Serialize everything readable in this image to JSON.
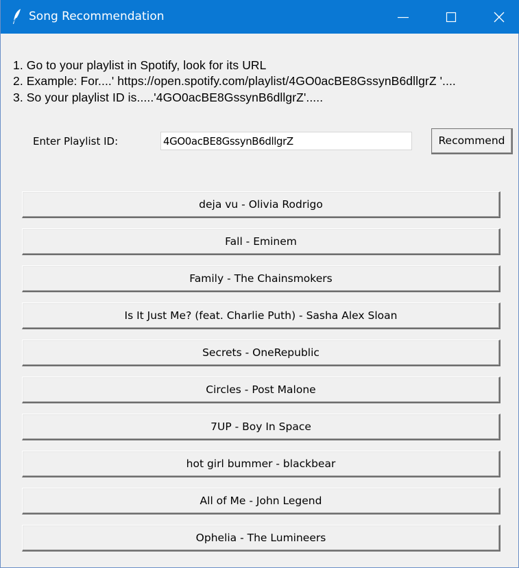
{
  "window": {
    "title": "Song Recommendation",
    "app_icon": "feather-icon",
    "controls": [
      "minimize-icon",
      "maximize-icon",
      "close-icon"
    ],
    "titlebar_color": "#0a78d4"
  },
  "instructions": [
    "1. Go to your playlist in Spotify, look for its URL",
    "2. Example: For....' https://open.spotify.com/playlist/4GO0acBE8GssynB6dllgrZ '....",
    "3. So your playlist ID is.....'4GO0acBE8GssynB6dllgrZ'....."
  ],
  "form": {
    "label": "Enter Playlist ID:",
    "playlist_id_value": "4GO0acBE8GssynB6dllgrZ",
    "recommend_label": "Recommend"
  },
  "songs": [
    "deja vu - Olivia Rodrigo",
    "Fall - Eminem",
    "Family - The Chainsmokers",
    "Is It Just Me? (feat. Charlie Puth) - Sasha Alex Sloan",
    "Secrets - OneRepublic",
    "Circles - Post Malone",
    "7UP - Boy In Space",
    "hot girl bummer - blackbear",
    "All of Me - John Legend",
    "Ophelia - The Lumineers"
  ]
}
